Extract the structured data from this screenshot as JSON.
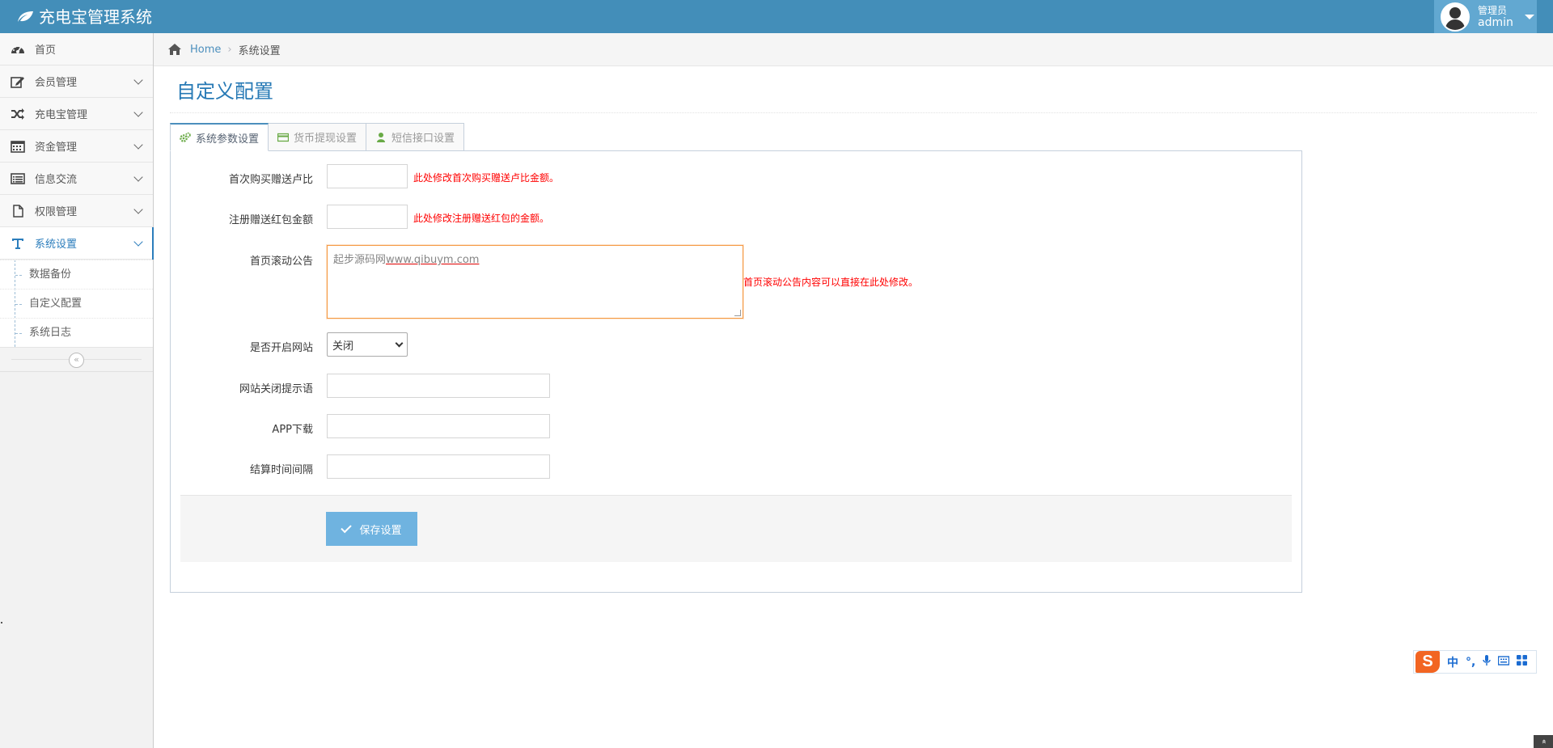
{
  "app": {
    "title": "充电宝管理系统"
  },
  "user": {
    "role": "管理员",
    "name": "admin"
  },
  "sidebar": {
    "items": [
      {
        "label": "首页",
        "icon": "dashboard-icon",
        "expandable": false
      },
      {
        "label": "会员管理",
        "icon": "edit-icon",
        "expandable": true
      },
      {
        "label": "充电宝管理",
        "icon": "random-icon",
        "expandable": true
      },
      {
        "label": "资金管理",
        "icon": "calendar-icon",
        "expandable": true
      },
      {
        "label": "信息交流",
        "icon": "list-alt-icon",
        "expandable": true
      },
      {
        "label": "权限管理",
        "icon": "file-icon",
        "expandable": true
      },
      {
        "label": "系统设置",
        "icon": "text-icon",
        "expandable": true,
        "active": true
      }
    ],
    "submenu": [
      {
        "label": "数据备份"
      },
      {
        "label": "自定义配置"
      },
      {
        "label": "系统日志"
      }
    ],
    "collapse_glyph": "«"
  },
  "breadcrumb": {
    "home": "Home",
    "separator": "›",
    "current": "系统设置"
  },
  "page": {
    "title": "自定义配置"
  },
  "tabs": [
    {
      "label": "系统参数设置",
      "icon": "cogs-icon",
      "active": true
    },
    {
      "label": "货币提现设置",
      "icon": "credit-card-icon",
      "active": false
    },
    {
      "label": "短信接口设置",
      "icon": "user-icon",
      "active": false
    }
  ],
  "form": {
    "fields": [
      {
        "label": "首次购买赠送卢比",
        "value": "",
        "help": "此处修改首次购买赠送卢比金额。"
      },
      {
        "label": "注册赠送红包金额",
        "value": "",
        "help": "此处修改注册赠送红包的金额。"
      },
      {
        "label": "首页滚动公告",
        "value_prefix": "起步源码网",
        "value_url": "www.qibuym.com",
        "help": "首页滚动公告内容可以直接在此处修改。"
      },
      {
        "label": "是否开启网站",
        "selected": "关闭"
      },
      {
        "label": "网站关闭提示语",
        "value": ""
      },
      {
        "label": "APP下载",
        "value": ""
      },
      {
        "label": "结算时间间隔",
        "value": ""
      }
    ],
    "save_label": "保存设置"
  },
  "ime": {
    "logo": "S",
    "items": [
      "中",
      "°,",
      "mic",
      "keyboard",
      "grid"
    ]
  },
  "scroll_top_glyph": "«",
  "colors": {
    "navbar": "#438eb9",
    "accent": "#2679b5",
    "help": "#ff0000",
    "save": "#6fb3e0"
  }
}
